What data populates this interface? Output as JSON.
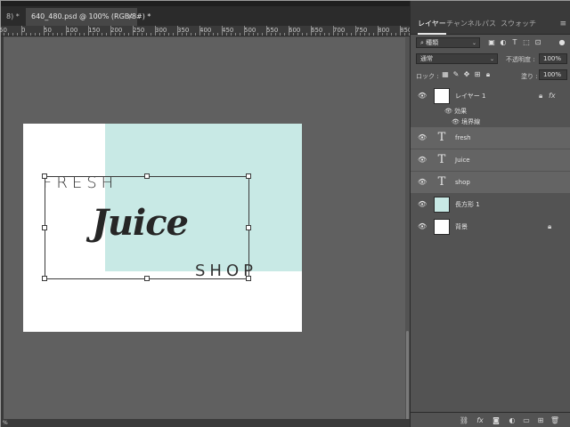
{
  "document": {
    "tabs": [
      {
        "label": "8) *"
      },
      {
        "label": "640_480.psd @ 100% (RGB/8#) *",
        "close": "×"
      }
    ],
    "ruler_numbers": [
      "50",
      "0",
      "50",
      "100",
      "150",
      "200",
      "250",
      "300",
      "350",
      "400",
      "450",
      "500",
      "550",
      "600",
      "650",
      "700",
      "750",
      "800",
      "850"
    ],
    "status": "%"
  },
  "artwork": {
    "fresh": "FRESH",
    "juice": "Juice",
    "shop": "SHOP",
    "teal_color": "#c8e9e5"
  },
  "panel": {
    "tabs": [
      "レイヤー",
      "チャンネル",
      "パス",
      "スウォッチ"
    ],
    "active_tab": "レイヤー",
    "filter": {
      "value": "種類"
    },
    "blend_mode": {
      "value": "通常"
    },
    "opacity": {
      "label": "不透明度 :",
      "value": "100%"
    },
    "lock": {
      "label": "ロック :"
    },
    "fill": {
      "label": "塗り :",
      "value": "100%"
    }
  },
  "layers": [
    {
      "name": "レイヤー 1",
      "kind": "pixel",
      "selected": false,
      "fx": "fx",
      "sub": [
        {
          "label": "効果"
        },
        {
          "label": "境界線"
        }
      ]
    },
    {
      "name": "fresh",
      "kind": "text",
      "selected": true
    },
    {
      "name": "Juice",
      "kind": "text",
      "selected": true
    },
    {
      "name": "shop",
      "kind": "text",
      "selected": true
    },
    {
      "name": "長方形 1",
      "kind": "shape",
      "selected": false
    },
    {
      "name": "背景",
      "kind": "background",
      "selected": false
    }
  ]
}
